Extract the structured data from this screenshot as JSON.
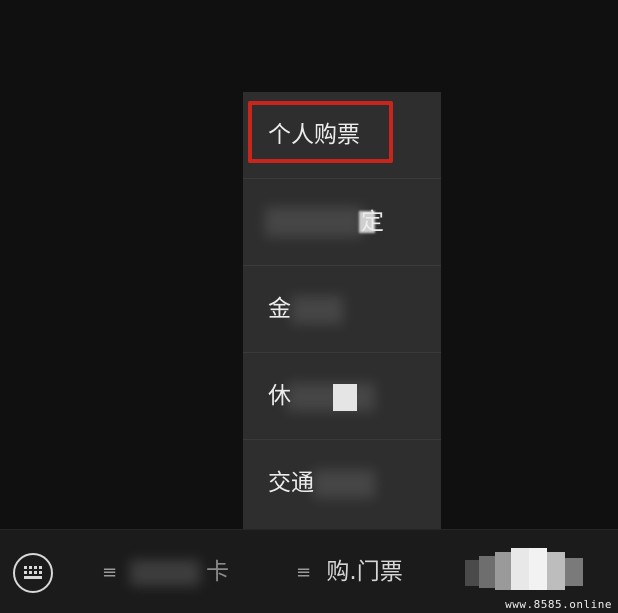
{
  "menu": {
    "items": [
      {
        "label": "个人购票",
        "highlighted": true
      },
      {
        "label": "定",
        "partially_obscured": true
      },
      {
        "label": "金",
        "partially_obscured": true
      },
      {
        "label": "休",
        "partially_obscured": true
      },
      {
        "label": "交通",
        "partially_obscured": true
      }
    ],
    "highlight_color": "#c8261c"
  },
  "bottom_bar": {
    "keyboard_icon": "keyboard-icon",
    "tabs": [
      {
        "label": "卡",
        "partially_obscured": true
      },
      {
        "label": "购.门票"
      }
    ],
    "menu_icon": "hamburger-icon"
  },
  "watermark": "www.8585.online"
}
